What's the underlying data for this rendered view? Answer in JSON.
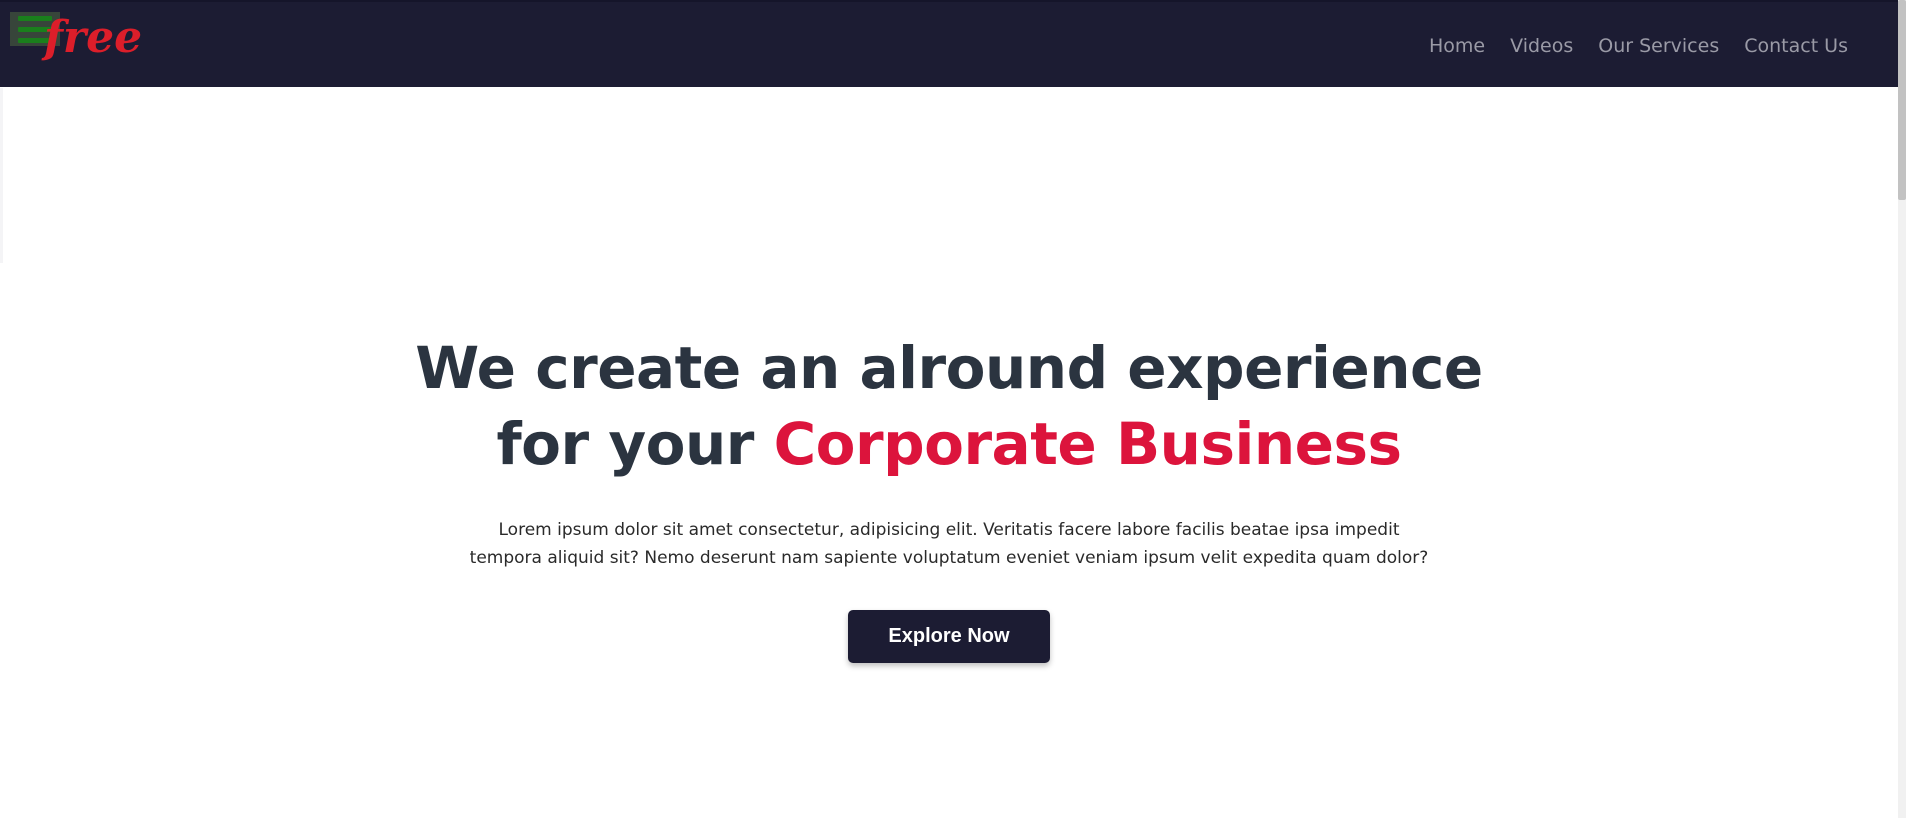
{
  "colors": {
    "navbar_bg": "#1c1c33",
    "accent": "#dc143c",
    "heading": "#2b3440",
    "nav_text": "#9a9aa6",
    "button_bg": "#1c1c33"
  },
  "navbar": {
    "menu_icon": "hamburger-menu-icon",
    "logo_text": "free",
    "links": [
      "Home",
      "Videos",
      "Our Services",
      "Contact Us"
    ]
  },
  "hero": {
    "title_line1": "We create an alround experience",
    "title_line2_prefix": "for your ",
    "title_line2_accent": "Corporate Business",
    "description_line1": "Lorem ipsum dolor sit amet consectetur, adipisicing elit. Veritatis facere labore facilis beatae ipsa impedit",
    "description_line2": "tempora aliquid sit? Nemo deserunt nam sapiente voluptatum eveniet veniam ipsum velit expedita quam dolor?",
    "button_label": "Explore Now"
  }
}
